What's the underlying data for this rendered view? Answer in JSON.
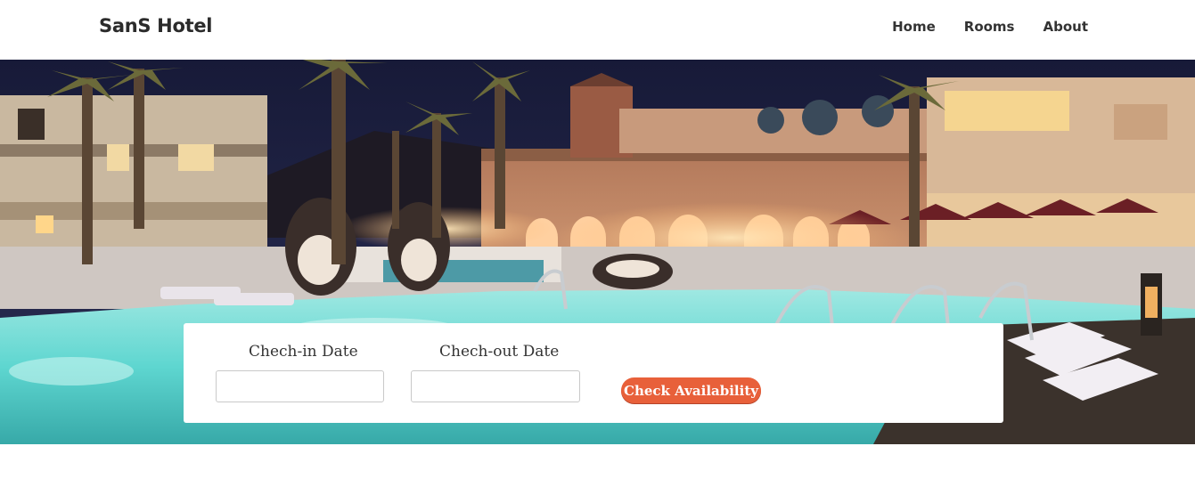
{
  "header": {
    "brand": "SanS Hotel",
    "nav": [
      "Home",
      "Rooms",
      "About"
    ]
  },
  "booking": {
    "checkin_label": "Chech-in Date",
    "checkout_label": "Chech-out Date",
    "checkin_value": "",
    "checkout_value": "",
    "button_label": "Check Availability"
  },
  "colors": {
    "accent": "#e8603a",
    "brand_text": "#2b2b2b",
    "pool": "#5ed6d0",
    "night_sky": "#1a1f3c"
  }
}
